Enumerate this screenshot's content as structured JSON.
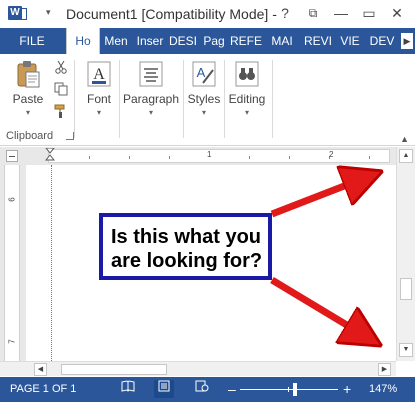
{
  "app": {
    "title": "Document1 [Compatibility Mode] -",
    "icon_letter": "W"
  },
  "window_buttons": {
    "help": "?",
    "ribbon_display": "⧉",
    "minimize": "—",
    "restore": "▭",
    "close": "✕"
  },
  "tabs": [
    {
      "label": "FILE"
    },
    {
      "label": "Ho"
    },
    {
      "label": "Men"
    },
    {
      "label": "Inser"
    },
    {
      "label": "DESI"
    },
    {
      "label": "Pag"
    },
    {
      "label": "REFE"
    },
    {
      "label": "MAI"
    },
    {
      "label": "REVI"
    },
    {
      "label": "VIE"
    },
    {
      "label": "DEV"
    }
  ],
  "tab_scroll": "▶",
  "ribbon": {
    "paste_label": "Paste",
    "font_label": "Font",
    "paragraph_label": "Paragraph",
    "styles_label": "Styles",
    "editing_label": "Editing",
    "dropdown": "▾",
    "clipboard_label": "Clipboard",
    "collapse": "▲"
  },
  "ruler": {
    "mark_1": "1",
    "mark_2": "2"
  },
  "vruler": {
    "mark_6": "6",
    "mark_7": "7"
  },
  "callout": {
    "text": "Is this what you are looking for?"
  },
  "scroll": {
    "up": "▲",
    "down": "▼",
    "left": "◀",
    "right": "▶"
  },
  "status": {
    "page": "PAGE 1 OF 1",
    "zoom_minus": "–",
    "zoom_plus": "+",
    "zoom_level": "147%"
  },
  "colors": {
    "accent": "#2b579a",
    "arrow": "#e11919",
    "callout_border": "#1a1aa6"
  },
  "icons": [
    "word-icon",
    "cut-icon",
    "copy-icon",
    "format-painter-icon",
    "paste-icon",
    "font-icon",
    "paragraph-icon",
    "styles-icon",
    "editing-icon",
    "read-mode-icon",
    "print-layout-icon",
    "web-layout-icon"
  ]
}
